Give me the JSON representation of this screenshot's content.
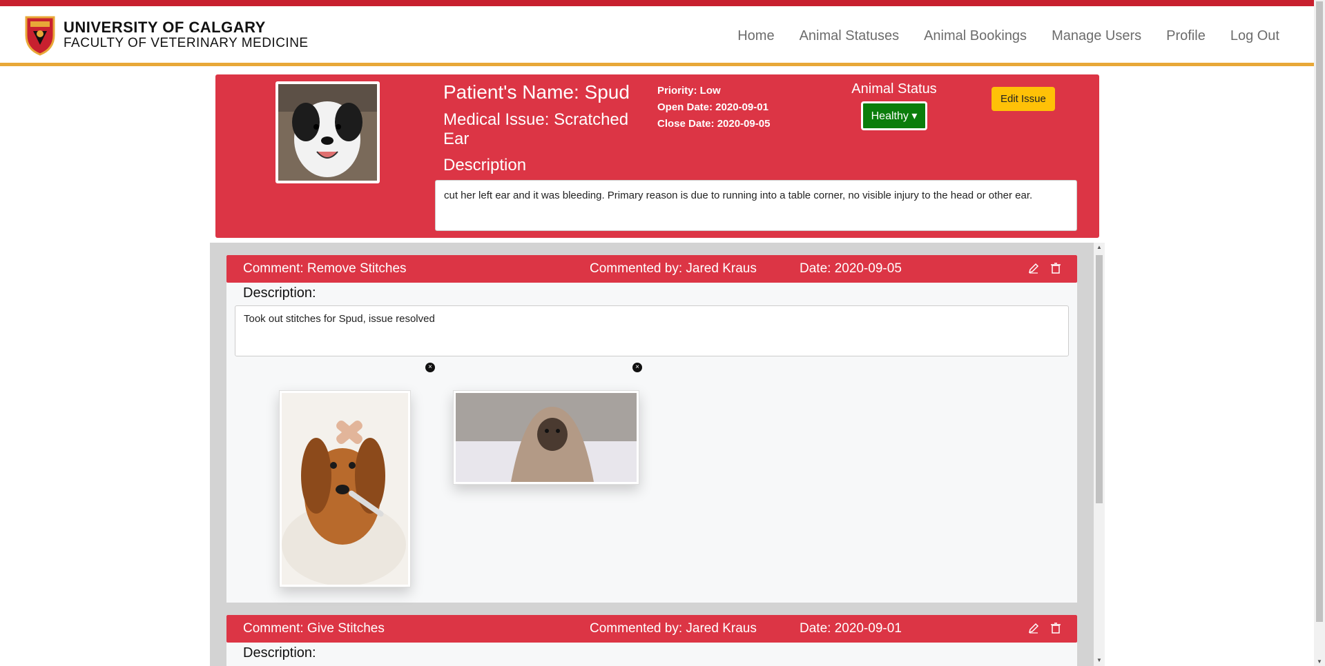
{
  "brand": {
    "line1": "UNIVERSITY OF CALGARY",
    "line2": "FACULTY OF VETERINARY MEDICINE"
  },
  "nav": {
    "items": [
      {
        "label": "Home"
      },
      {
        "label": "Animal Statuses"
      },
      {
        "label": "Animal Bookings"
      },
      {
        "label": "Manage Users"
      },
      {
        "label": "Profile"
      },
      {
        "label": "Log Out"
      }
    ]
  },
  "issue": {
    "patient_name": "Patient's Name: Spud",
    "medical_issue": "Medical Issue: Scratched Ear",
    "description_heading": "Description",
    "priority": "Priority: Low",
    "open_date": "Open Date: 2020-09-01",
    "close_date": "Close Date: 2020-09-05",
    "status_title": "Animal Status",
    "status_value": "Healthy",
    "edit_label": "Edit Issue",
    "description": "cut her left ear and it was bleeding. Primary reason is due to running into a table corner, no visible injury to the head or other ear."
  },
  "comments": [
    {
      "title": "Comment: Remove Stitches",
      "by": "Commented by: Jared Kraus",
      "date": "Date: 2020-09-05",
      "description_label": "Description:",
      "description": "Took out stitches for Spud, issue resolved"
    },
    {
      "title": "Comment: Give Stitches",
      "by": "Commented by: Jared Kraus",
      "date": "Date: 2020-09-01",
      "description_label": "Description:",
      "description": ""
    }
  ],
  "colors": {
    "header_red": "#dc3545",
    "top_strip": "#c8202f",
    "accent_gold": "#e8a838",
    "status_green": "#0b7d0b",
    "edit_yellow": "#ffc107"
  }
}
